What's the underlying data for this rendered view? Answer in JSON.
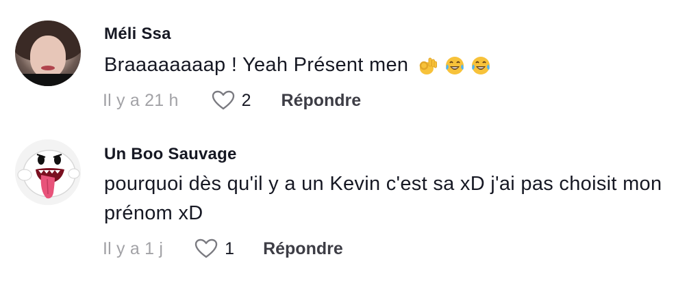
{
  "comments": [
    {
      "username": "Méli Ssa",
      "text": "Braaaaaaaap ! Yeah Présent men",
      "emojis": [
        "ok-hand-emoji",
        "tears-of-joy-emoji",
        "tears-of-joy-emoji"
      ],
      "timestamp": "Il y a 21 h",
      "likes": "2",
      "reply_label": "Répondre"
    },
    {
      "username": "Un Boo Sauvage",
      "text": "pourquoi dès qu'il y a un Kevin c'est sa xD j'ai pas choisit mon prénom xD",
      "timestamp": "Il y a 1 j",
      "likes": "1",
      "reply_label": "Répondre"
    }
  ],
  "colors": {
    "text": "#161823",
    "meta": "#a2a2a6",
    "reply": "#3d3d45"
  }
}
